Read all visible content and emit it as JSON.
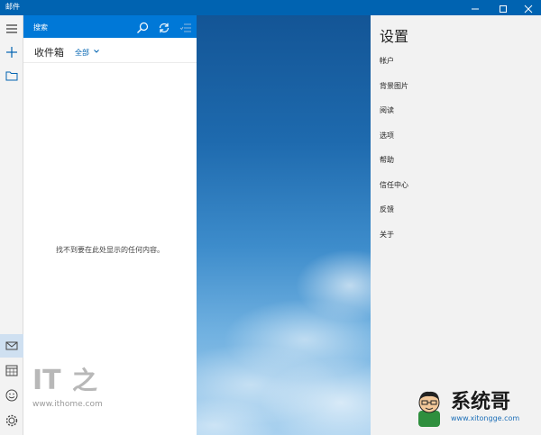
{
  "window": {
    "title": "邮件"
  },
  "colors": {
    "titlebar": "#0063b1",
    "accent": "#0078d7",
    "rail": "#f3f3f3",
    "settings_bg": "#f2f2f2"
  },
  "rail": {
    "icons": [
      "hamburger-icon",
      "plus-icon",
      "folder-icon",
      "mail-icon",
      "calendar-icon",
      "smiley-icon",
      "gear-icon"
    ]
  },
  "list": {
    "search": "搜索",
    "inbox": "收件箱",
    "filter": "全部",
    "empty": "找不到要在此处显示的任何内容。"
  },
  "settings": {
    "title": "设置",
    "items": [
      "帐户",
      "背景图片",
      "阅读",
      "选项",
      "帮助",
      "信任中心",
      "反馈",
      "关于"
    ]
  },
  "watermarks": {
    "ithome": {
      "logo": "IT之家",
      "url": "www.ithome.com"
    },
    "xitongge": {
      "brand": "系统哥",
      "url": "www.xitongge.com"
    }
  }
}
